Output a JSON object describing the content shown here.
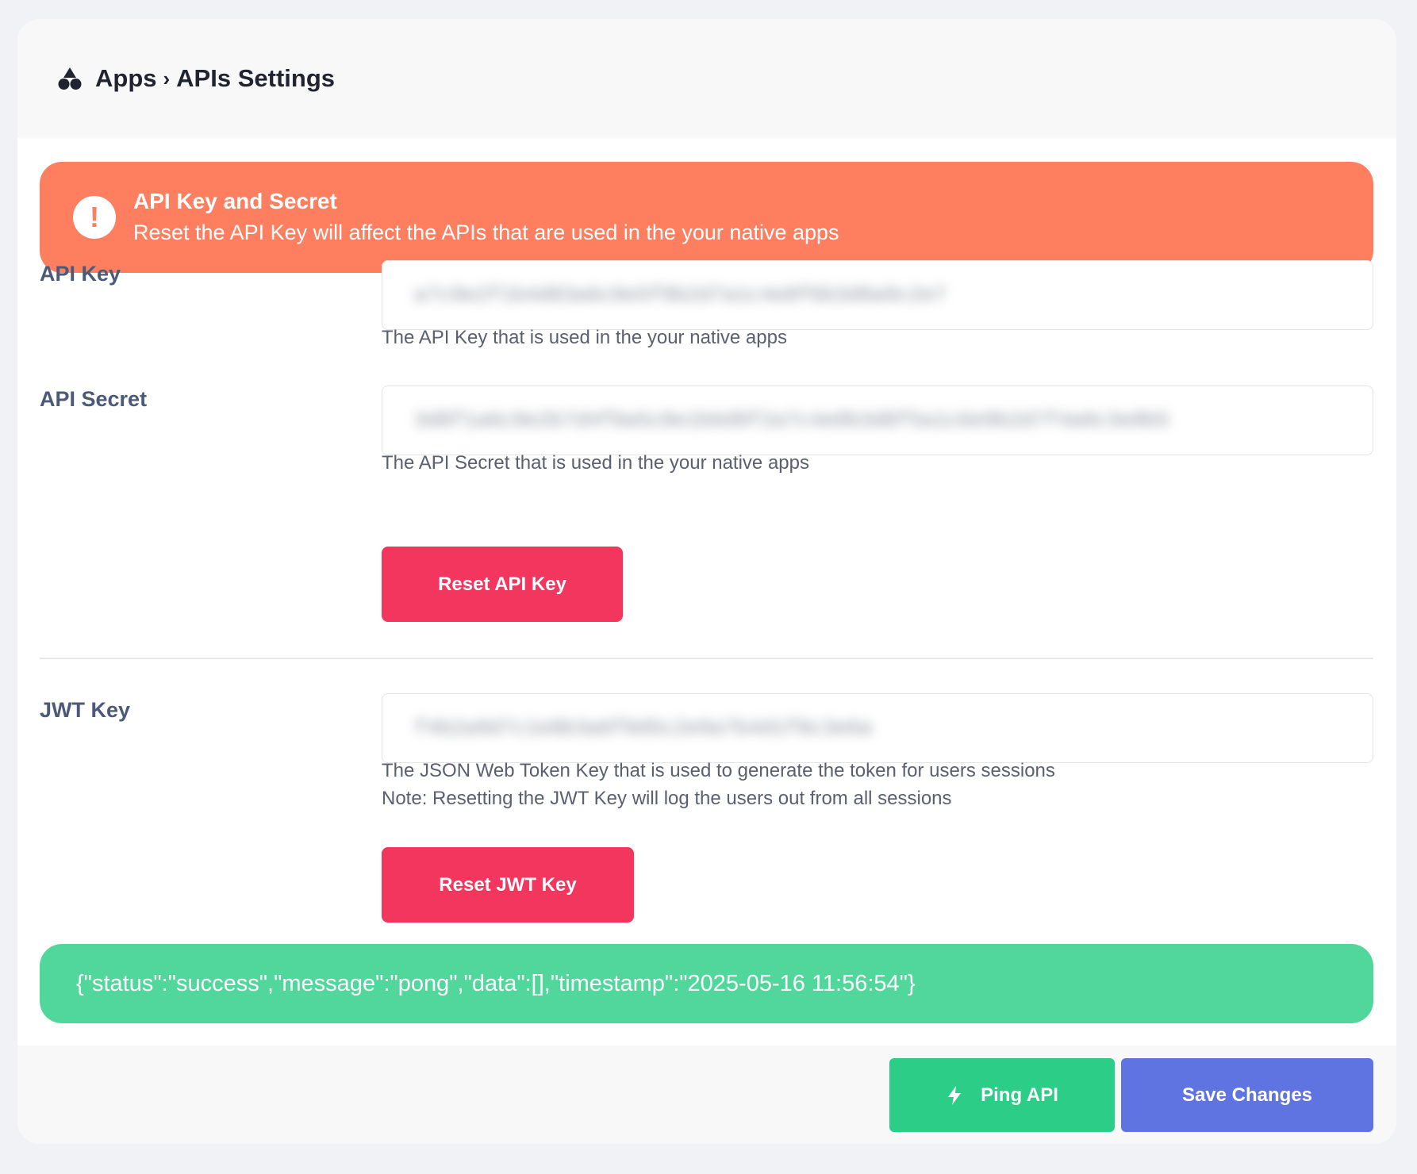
{
  "header": {
    "icon": "apps-icon",
    "breadcrumb_root": "Apps",
    "breadcrumb_separator": "›",
    "breadcrumb_current": "APIs Settings"
  },
  "alert": {
    "icon": "exclamation-icon",
    "title": "API Key and Secret",
    "text": "Reset the API Key will affect the APIs that are used in the your native apps",
    "color": "#fe7e60"
  },
  "api_key": {
    "label": "API Key",
    "value": "a7c9e2f1b4d83a6c0e5f9b2d7a1c4e8f6b3d0a9c2e7",
    "help": "The API Key that is used in the your native apps"
  },
  "api_secret": {
    "label": "API Secret",
    "value": "3d8f1a6c9e2b7d4f0a5c8e1b6d9f2a7c4e0b3d8f5a1c6e9b2d7f4a0c3e8b5",
    "help": "The API Secret that is used in the your native apps"
  },
  "reset_api_button": "Reset API Key",
  "jwt_key": {
    "label": "JWT Key",
    "value": "f4b2a9d7c1e8b3a6f0d5c2e9a7b4d1f8c3e6a",
    "help_line1": "The JSON Web Token Key that is used to generate the token for users sessions",
    "help_line2": "Note: Resetting the JWT Key will log the users out from all sessions"
  },
  "reset_jwt_button": "Reset JWT Key",
  "response": {
    "text": "{\"status\":\"success\",\"message\":\"pong\",\"data\":[],\"timestamp\":\"2025-05-16 11:56:54\"}",
    "color": "#51d69c"
  },
  "footer": {
    "ping_icon": "lightning-bolt-icon",
    "ping_label": "Ping API",
    "save_label": "Save Changes"
  },
  "colors": {
    "danger": "#f2365d",
    "success": "#2ccd86",
    "primary": "#5f73e1"
  }
}
